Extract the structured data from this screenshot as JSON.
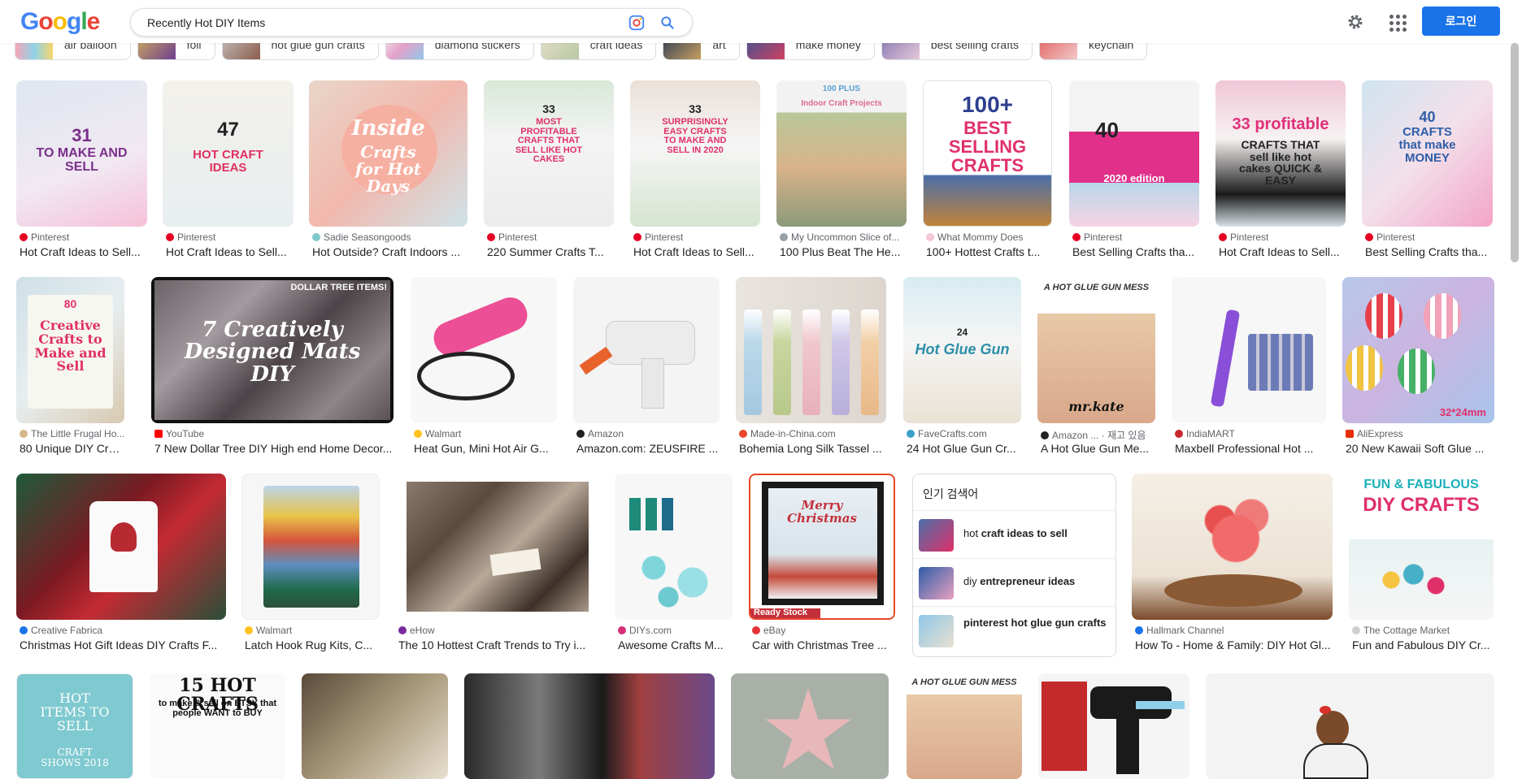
{
  "header": {
    "logo_letters": [
      "G",
      "o",
      "o",
      "g",
      "l",
      "e"
    ],
    "logo_colors": [
      "#4285F4",
      "#EA4335",
      "#FBBC05",
      "#4285F4",
      "#34A853",
      "#EA4335"
    ],
    "search_value": "Recently Hot DIY Items",
    "login_label": "로그인",
    "icons": [
      "google-lens-icon",
      "search-icon",
      "gear-icon",
      "apps-icon"
    ]
  },
  "chips": [
    "air balloon",
    "foil",
    "hot glue gun crafts",
    "diamond stickers",
    "craft ideas",
    "art",
    "make money",
    "best selling crafts",
    "keychain"
  ],
  "row1": [
    {
      "source": "Pinterest",
      "title": "Hot Craft Ideas to Sell...",
      "thumb": [
        "31",
        "TO MAKE AND SELL"
      ]
    },
    {
      "source": "Pinterest",
      "title": "Hot Craft Ideas to Sell...",
      "thumb": [
        "47",
        "HOT CRAFT IDEAS"
      ]
    },
    {
      "source": "Sadie Seasongoods",
      "title": "Hot Outside? Craft Indoors ...",
      "thumb": [
        "Inside",
        "Crafts for Hot Days"
      ]
    },
    {
      "source": "Pinterest",
      "title": "220 Summer Crafts T...",
      "thumb": [
        "33",
        "MOST PROFITABLE CRAFTS THAT SELL LIKE HOT CAKES"
      ]
    },
    {
      "source": "Pinterest",
      "title": "Hot Craft Ideas to Sell...",
      "thumb": [
        "33",
        "SURPRISINGLY EASY CRAFTS TO MAKE AND SELL IN 2020"
      ]
    },
    {
      "source": "My Uncommon Slice of...",
      "title": "100 Plus Beat The He...",
      "thumb": [
        "100 PLUS",
        "Indoor Craft Projects"
      ]
    },
    {
      "source": "What Mommy Does",
      "title": "100+ Hottest Crafts t...",
      "thumb": [
        "100+",
        "BEST SELLING CRAFTS"
      ]
    },
    {
      "source": "Pinterest",
      "title": "Best Selling Crafts tha...",
      "thumb": [
        "40",
        "2020 edition"
      ]
    },
    {
      "source": "Pinterest",
      "title": "Hot Craft Ideas to Sell...",
      "thumb": [
        "33 profitable",
        "CRAFTS THAT sell like hot cakes QUICK & EASY"
      ]
    },
    {
      "source": "Pinterest",
      "title": "Best Selling Crafts tha...",
      "thumb": [
        "40",
        "CRAFTS that make MONEY"
      ]
    }
  ],
  "row2": [
    {
      "source": "The Little Frugal Ho...",
      "title": "80 Unique DIY Craft...",
      "thumb": [
        "80",
        "Creative Crafts to Make and Sell"
      ]
    },
    {
      "source": "YouTube",
      "title": "7 New Dollar Tree DIY High end Home Decor...",
      "thumb": [
        "DOLLAR TREE ITEMS!",
        "7 Creatively Designed Mats DIY"
      ]
    },
    {
      "source": "Walmart",
      "title": "Heat Gun, Mini Hot Air G...",
      "thumb": [
        "",
        ""
      ]
    },
    {
      "source": "Amazon",
      "title": "Amazon.com: ZEUSFIRE ...",
      "thumb": [
        "",
        ""
      ]
    },
    {
      "source": "Made-in-China.com",
      "title": "Bohemia Long Silk Tassel ...",
      "thumb": [
        "",
        ""
      ]
    },
    {
      "source": "FaveCrafts.com",
      "title": "24 Hot Glue Gun Cr...",
      "thumb": [
        "24",
        "Hot Glue Gun"
      ]
    },
    {
      "source": "Amazon ... · 재고 있음",
      "title": "A Hot Glue Gun Me...",
      "thumb": [
        "A HOT GLUE GUN MESS",
        "mr.kate"
      ]
    },
    {
      "source": "IndiaMART",
      "title": "Maxbell Professional Hot ...",
      "thumb": [
        "",
        ""
      ]
    },
    {
      "source": "AliExpress",
      "title": "20 New Kawaii Soft Glue ...",
      "thumb": [
        "32*24mm",
        ""
      ]
    }
  ],
  "row3": [
    {
      "source": "Creative Fabrica",
      "title": "Christmas Hot Gift Ideas DIY Crafts F...",
      "thumb": [
        "",
        ""
      ]
    },
    {
      "source": "Walmart",
      "title": "Latch Hook Rug Kits, C...",
      "thumb": [
        "",
        ""
      ]
    },
    {
      "source": "eHow",
      "title": "The 10 Hottest Craft Trends to Try i...",
      "thumb": [
        "",
        ""
      ]
    },
    {
      "source": "DIYs.com",
      "title": "Awesome Crafts M...",
      "thumb": [
        "",
        ""
      ]
    },
    {
      "source": "eBay",
      "title": "Car with Christmas Tree ...",
      "thumb": [
        "Merry Christmas",
        "Ready Stock"
      ]
    },
    {
      "source": "Hallmark Channel",
      "title": "How To - Home & Family: DIY Hot Gl...",
      "thumb": [
        "",
        ""
      ]
    },
    {
      "source": "The Cottage Market",
      "title": "Fun and Fabulous DIY Cr...",
      "thumb": [
        "FUN & FABULOUS",
        "DIY CRAFTS"
      ]
    }
  ],
  "related": {
    "title": "인기 검색어",
    "items": [
      {
        "prefix": "hot ",
        "bold": "craft ideas to sell"
      },
      {
        "prefix": "diy ",
        "bold": "entrepreneur ideas"
      },
      {
        "prefix": "pinterest ",
        "bold": "hot glue gun crafts",
        "prefix_bold": true
      }
    ]
  },
  "row4": [
    {
      "thumb": [
        "HOT ITEMS TO SELL",
        "CRAFT SHOWS 2018"
      ]
    },
    {
      "thumb": [
        "15 HOT CRAFTS",
        "to make & sell on ETSY that people WANT to BUY"
      ]
    },
    {
      "thumb": [
        "",
        ""
      ]
    },
    {
      "thumb": [
        "",
        ""
      ]
    },
    {
      "thumb": [
        "",
        ""
      ]
    },
    {
      "thumb": [
        "A HOT GLUE GUN MESS",
        ""
      ]
    },
    {
      "thumb": [
        "",
        ""
      ]
    },
    {
      "thumb": [
        "",
        ""
      ]
    }
  ],
  "colors": {
    "accent": "#1a73e8",
    "pinterest": "#e60023"
  }
}
